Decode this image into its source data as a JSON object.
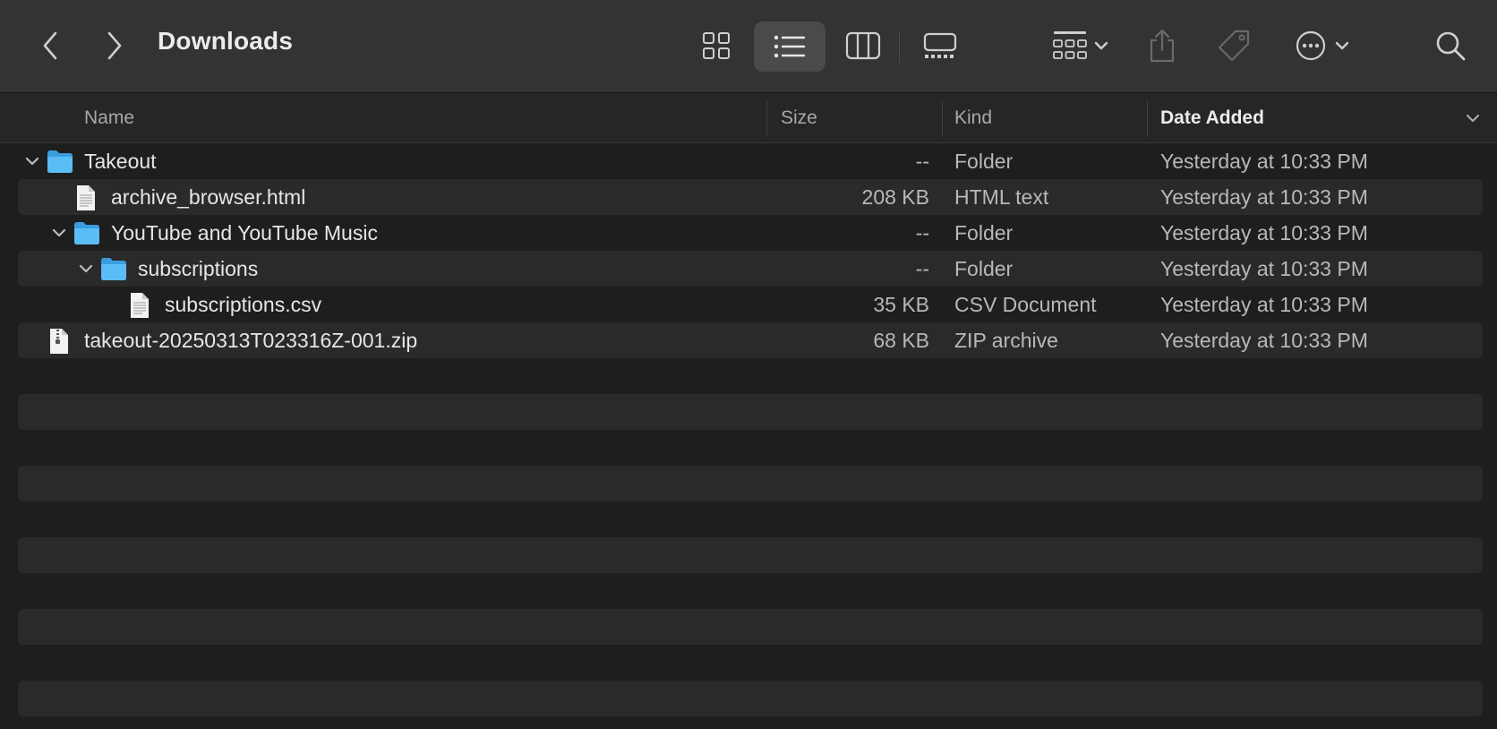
{
  "window": {
    "title": "Downloads"
  },
  "toolbar": {
    "back_icon": "chevron-left-icon",
    "forward_icon": "chevron-right-icon",
    "views": [
      "icon-view-icon",
      "list-view-icon",
      "column-view-icon",
      "gallery-view-icon"
    ],
    "selected_view": "list-view-icon"
  },
  "columns": {
    "name": "Name",
    "size": "Size",
    "kind": "Kind",
    "date": "Date Added"
  },
  "rows": [
    {
      "name": "Takeout",
      "size": "--",
      "kind": "Folder",
      "date": "Yesterday at 10:33 PM",
      "icon": "folder-icon",
      "expanded": true
    },
    {
      "name": "archive_browser.html",
      "size": "208 KB",
      "kind": "HTML text",
      "date": "Yesterday at 10:33 PM",
      "icon": "document-icon"
    },
    {
      "name": "YouTube and YouTube Music",
      "size": "--",
      "kind": "Folder",
      "date": "Yesterday at 10:33 PM",
      "icon": "folder-icon",
      "expanded": true
    },
    {
      "name": "subscriptions",
      "size": "--",
      "kind": "Folder",
      "date": "Yesterday at 10:33 PM",
      "icon": "folder-icon",
      "expanded": true
    },
    {
      "name": "subscriptions.csv",
      "size": "35 KB",
      "kind": "CSV Document",
      "date": "Yesterday at 10:33 PM",
      "icon": "document-icon"
    },
    {
      "name": "takeout-20250313T023316Z-001.zip",
      "size": "68 KB",
      "kind": "ZIP archive",
      "date": "Yesterday at 10:33 PM",
      "icon": "zip-icon"
    }
  ],
  "colors": {
    "folder": "#4fb4f0",
    "toolbar": "#333333",
    "background": "#1e1e1e"
  }
}
